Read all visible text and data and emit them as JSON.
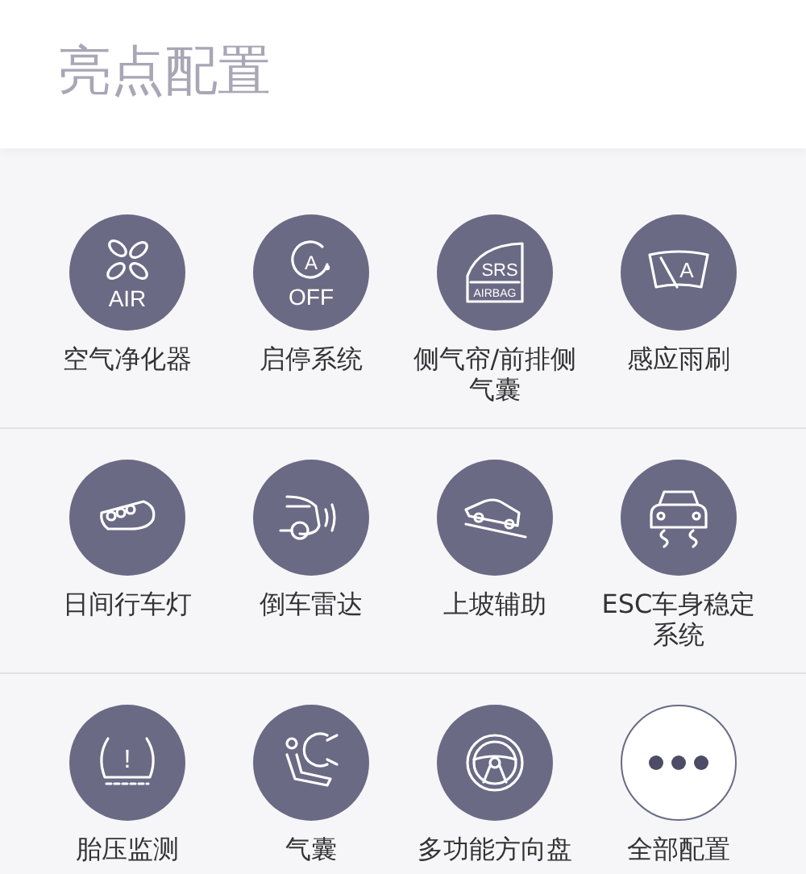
{
  "header": {
    "title": "亮点配置"
  },
  "rows": [
    {
      "items": [
        {
          "kind": "air",
          "label": "空气净化器",
          "icon_text": [
            "AIR"
          ]
        },
        {
          "kind": "stopstart",
          "label": "启停系统",
          "icon_text": [
            "A",
            "OFF"
          ]
        },
        {
          "kind": "airbag-badge",
          "label": "侧气帘/前排侧气囊",
          "icon_text": [
            "SRS",
            "AIRBAG"
          ]
        },
        {
          "kind": "wiper",
          "label": "感应雨刷",
          "icon_text": [
            "A"
          ]
        }
      ]
    },
    {
      "items": [
        {
          "kind": "drl",
          "label": "日间行车灯"
        },
        {
          "kind": "radar",
          "label": "倒车雷达"
        },
        {
          "kind": "hill",
          "label": "上坡辅助"
        },
        {
          "kind": "esc",
          "label": "ESC车身稳定系统"
        }
      ]
    },
    {
      "items": [
        {
          "kind": "tire",
          "label": "胎压监测",
          "icon_text": [
            "!"
          ]
        },
        {
          "kind": "airbag",
          "label": "气囊"
        },
        {
          "kind": "wheel",
          "label": "多功能方向盘"
        },
        {
          "kind": "more",
          "label": "全部配置"
        }
      ]
    }
  ]
}
